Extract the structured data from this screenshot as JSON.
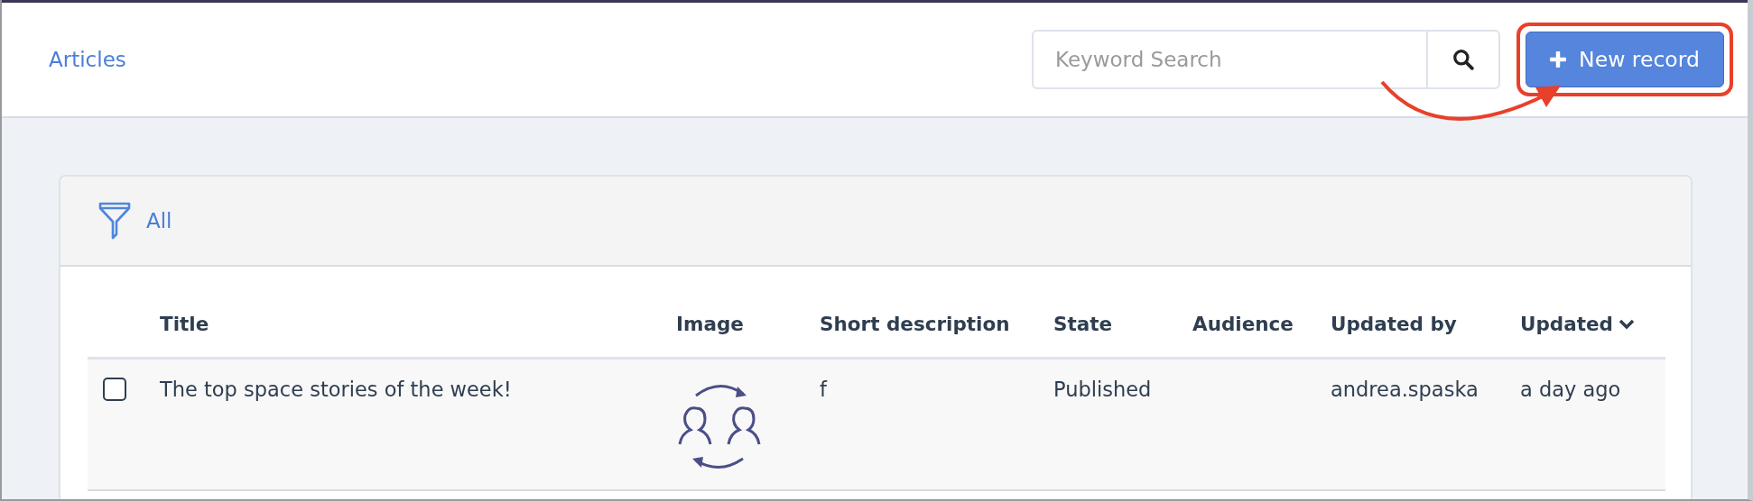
{
  "header": {
    "breadcrumb": "Articles",
    "search": {
      "placeholder": "Keyword Search"
    },
    "new_button": {
      "label": "New record",
      "highlighted": true
    }
  },
  "filter": {
    "label": "All"
  },
  "table": {
    "columns": [
      {
        "label": "Title",
        "sorted": false
      },
      {
        "label": "Image",
        "sorted": false
      },
      {
        "label": "Short description",
        "sorted": false
      },
      {
        "label": "State",
        "sorted": false
      },
      {
        "label": "Audience",
        "sorted": false
      },
      {
        "label": "Updated by",
        "sorted": false
      },
      {
        "label": "Updated",
        "sorted": true
      }
    ],
    "rows": [
      {
        "selected": false,
        "cells": [
          "The top space stories of the week!",
          null,
          "f",
          "Published",
          null,
          "andrea.spaska",
          "a day ago"
        ]
      }
    ]
  }
}
